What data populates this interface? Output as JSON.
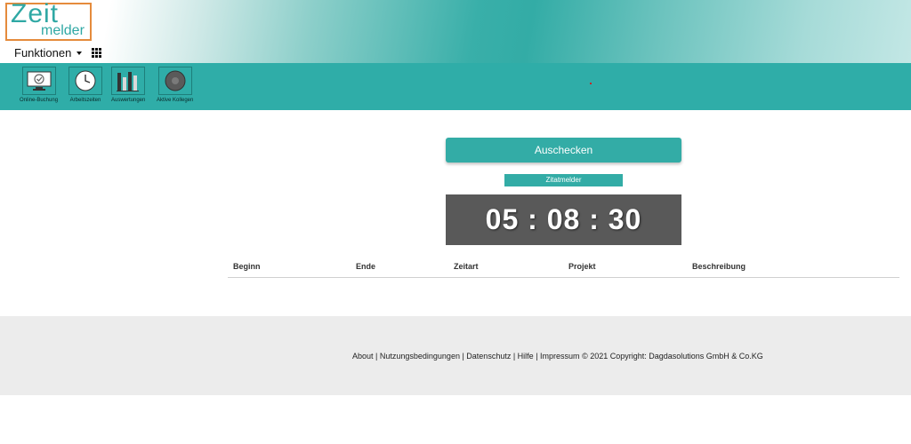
{
  "logo": {
    "line1": "Zeit",
    "line2": "melder"
  },
  "menu": {
    "functions_label": "Funktionen"
  },
  "toolbar": {
    "items": [
      {
        "label": "Online-Buchung",
        "icon": "monitor-check-icon"
      },
      {
        "label": "Arbeitszeiten",
        "icon": "clock-icon"
      },
      {
        "label": "Auswertungen",
        "icon": "bar-chart-icon"
      },
      {
        "label": "Aktive Kollegen",
        "icon": "power-toggle-icon"
      }
    ]
  },
  "main": {
    "checkout_label": "Auschecken",
    "quote_label": "Zitatmelder",
    "timer": "05 : 08 : 30"
  },
  "table": {
    "headers": [
      "Beginn",
      "Ende",
      "Zeitart",
      "Projekt",
      "Beschreibung"
    ]
  },
  "footer": {
    "links": [
      "About",
      "Nutzungsbedingungen",
      "Datenschutz",
      "Hilfe",
      "Impressum"
    ],
    "copyright": "© 2021 Copyright: Dagdasolutions GmbH & Co.KG"
  },
  "colors": {
    "accent": "#2fada8",
    "logo_border": "#e58b3c",
    "timer_bg": "#595959"
  }
}
